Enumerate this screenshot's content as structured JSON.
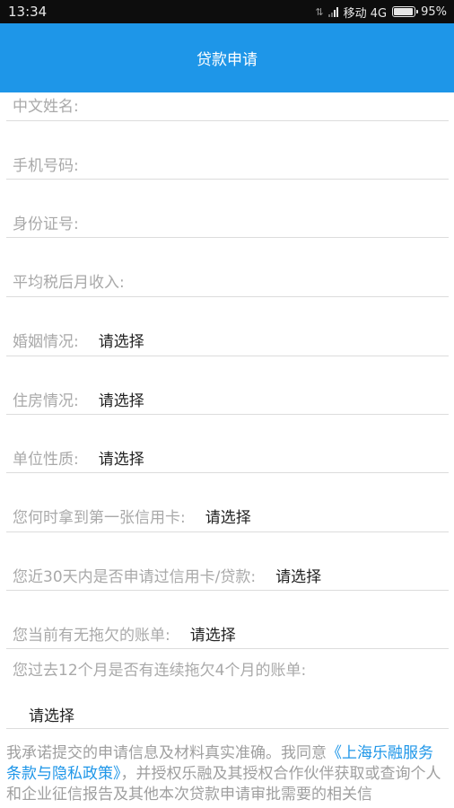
{
  "status_bar": {
    "time": "13:34",
    "carrier": "移动 4G",
    "battery": "95%",
    "battery_level": 0.95
  },
  "header": {
    "title": "贷款申请"
  },
  "form": {
    "name_label": "中文姓名:",
    "phone_label": "手机号码:",
    "id_label": "身份证号:",
    "income_label": "平均税后月收入:",
    "marital": {
      "label": "婚姻情况:",
      "value": "请选择"
    },
    "housing": {
      "label": "住房情况:",
      "value": "请选择"
    },
    "employer": {
      "label": "单位性质:",
      "value": "请选择"
    },
    "first_card": {
      "label": "您何时拿到第一张信用卡:",
      "value": "请选择"
    },
    "recent_apply": {
      "label": "您近30天内是否申请过信用卡/贷款:",
      "value": "请选择"
    },
    "overdue_now": {
      "label": "您当前有无拖欠的账单:",
      "value": "请选择"
    },
    "overdue_history": {
      "label": "您过去12个月是否有连续拖欠4个月的账单:",
      "value": "请选择"
    }
  },
  "agreement": {
    "prefix": "我承诺提交的申请信息及材料真实准确。我同意",
    "link": "《上海乐融服务条款与隐私政策》",
    "suffix": "，并授权乐融及其授权合作伙伴获取或查询个人和企业征信报告及其他本次贷款申请审批需要的相关信"
  },
  "colors": {
    "accent": "#1e96e8",
    "label": "#a9a9a9",
    "divider": "#dcdcdc"
  }
}
